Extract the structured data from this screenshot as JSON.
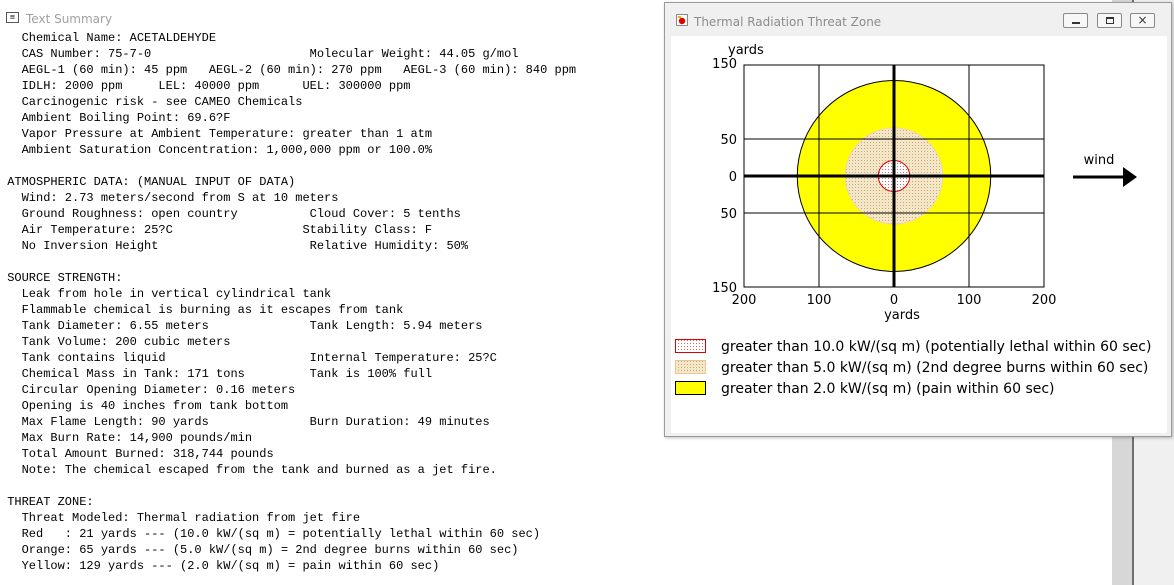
{
  "text_summary": {
    "title": "Text Summary",
    "lines": [
      "   Chemical Name: ACETALDEHYDE",
      "   CAS Number: 75-7-0                      Molecular Weight: 44.05 g/mol",
      "   AEGL-1 (60 min): 45 ppm   AEGL-2 (60 min): 270 ppm   AEGL-3 (60 min): 840 ppm",
      "   IDLH: 2000 ppm     LEL: 40000 ppm      UEL: 300000 ppm",
      "   Carcinogenic risk - see CAMEO Chemicals",
      "   Ambient Boiling Point: 69.6?F",
      "   Vapor Pressure at Ambient Temperature: greater than 1 atm",
      "   Ambient Saturation Concentration: 1,000,000 ppm or 100.0%",
      "",
      " ATMOSPHERIC DATA: (MANUAL INPUT OF DATA)",
      "   Wind: 2.73 meters/second from S at 10 meters",
      "   Ground Roughness: open country          Cloud Cover: 5 tenths",
      "   Air Temperature: 25?C                  Stability Class: F",
      "   No Inversion Height                     Relative Humidity: 50%",
      "",
      " SOURCE STRENGTH:",
      "   Leak from hole in vertical cylindrical tank",
      "   Flammable chemical is burning as it escapes from tank",
      "   Tank Diameter: 6.55 meters              Tank Length: 5.94 meters",
      "   Tank Volume: 200 cubic meters",
      "   Tank contains liquid                    Internal Temperature: 25?C",
      "   Chemical Mass in Tank: 171 tons         Tank is 100% full",
      "   Circular Opening Diameter: 0.16 meters",
      "   Opening is 40 inches from tank bottom",
      "   Max Flame Length: 90 yards              Burn Duration: 49 minutes",
      "   Max Burn Rate: 14,900 pounds/min",
      "   Total Amount Burned: 318,744 pounds",
      "   Note: The chemical escaped from the tank and burned as a jet fire.",
      "",
      " THREAT ZONE:",
      "   Threat Modeled: Thermal radiation from jet fire",
      "   Red   : 21 yards --- (10.0 kW/(sq m) = potentially lethal within 60 sec)",
      "   Orange: 65 yards --- (5.0 kW/(sq m) = 2nd degree burns within 60 sec)",
      "   Yellow: 129 yards --- (2.0 kW/(sq m) = pain within 60 sec)"
    ]
  },
  "threat_zone_window": {
    "title": "Thermal Radiation Threat Zone",
    "icon": "flame-window-icon",
    "buttons": {
      "minimize": "minimize-icon",
      "maximize": "maximize-icon",
      "close": "×"
    },
    "plot": {
      "y_unit_label": "yards",
      "x_unit_label": "yards",
      "x_ticks": [
        "200",
        "100",
        "0",
        "100",
        "200"
      ],
      "y_ticks": [
        "150",
        "50",
        "0",
        "50",
        "150"
      ],
      "x_range": [
        -200,
        200
      ],
      "y_range": [
        -150,
        150
      ],
      "wind_label": "wind",
      "zones": [
        {
          "name": "red",
          "radius_yards": 21,
          "fill": "#ffffff",
          "stroke": "#e00000",
          "dot_color": "#e06060"
        },
        {
          "name": "orange",
          "radius_yards": 65,
          "fill": "#f1e4c2",
          "stroke": "#f0d8a0",
          "dot_color": "#c8a878"
        },
        {
          "name": "yellow",
          "radius_yards": 129,
          "fill": "#ffff00",
          "stroke": "#000000"
        }
      ]
    },
    "legend": [
      {
        "label": "greater than 10.0 kW/(sq m) (potentially lethal within 60 sec)",
        "swatch": "red-dotted"
      },
      {
        "label": "greater than 5.0 kW/(sq m) (2nd degree burns within 60 sec)",
        "swatch": "orange-dotted"
      },
      {
        "label": "greater than 2.0 kW/(sq m) (pain within 60 sec)",
        "swatch": "yellow-solid"
      }
    ]
  }
}
